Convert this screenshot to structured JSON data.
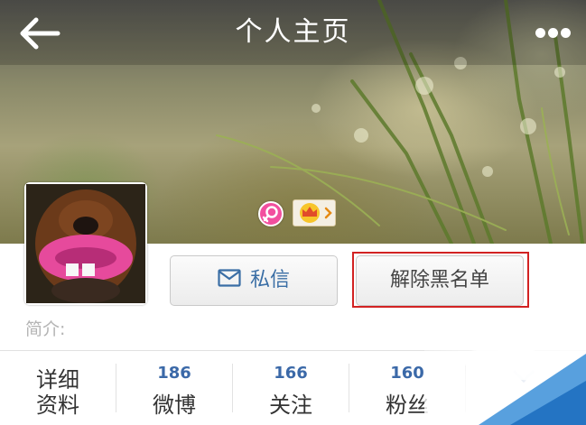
{
  "header": {
    "title": "个人主页",
    "back_icon": "arrow-left-icon",
    "more_icon": "more-horizontal-icon"
  },
  "profile": {
    "gender_icon": "female-icon",
    "vip_icon": "crown-icon",
    "avatar": "dog-avatar",
    "bio_label": "简介:"
  },
  "actions": {
    "message_label": "私信",
    "message_icon": "mail-icon",
    "unblock_label": "解除黑名单"
  },
  "stats": {
    "details_line1": "详细",
    "details_line2": "资料",
    "weibo_count": "186",
    "weibo_label": "微博",
    "following_count": "166",
    "following_label": "关注",
    "followers_count": "160",
    "followers_label": "粉丝"
  },
  "colors": {
    "accent_blue": "#3b69a8",
    "highlight_red": "#d22222",
    "female_pink": "#f24f9e"
  }
}
